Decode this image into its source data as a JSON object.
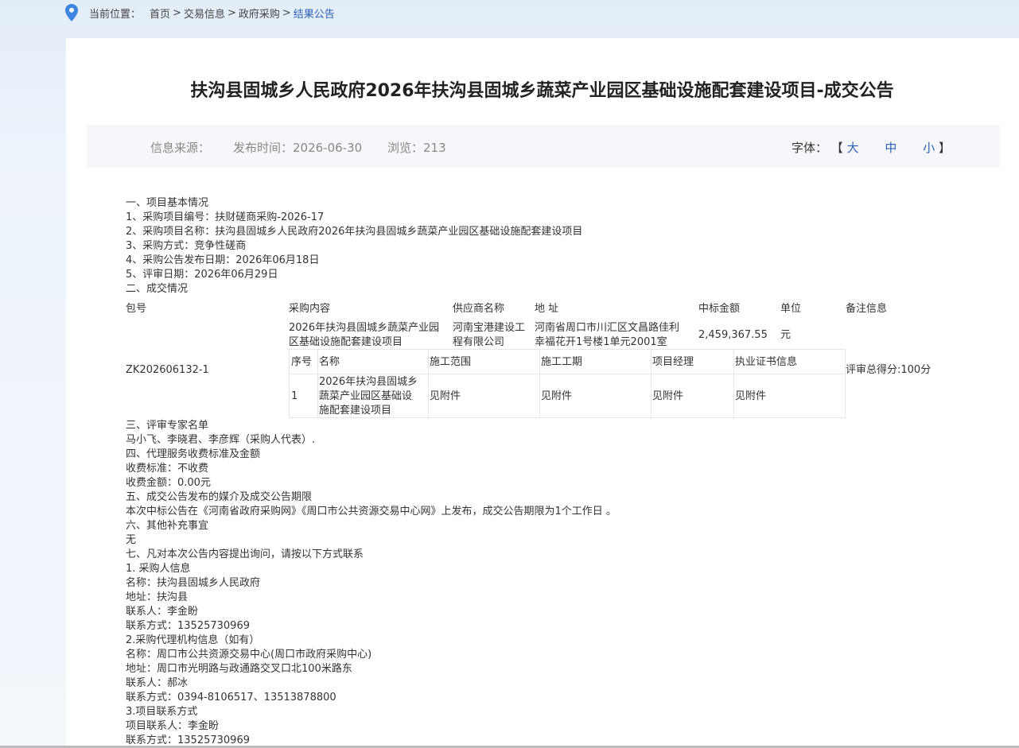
{
  "breadcrumb": {
    "prefix": "当前位置：",
    "items": [
      "首页",
      "交易信息",
      "政府采购"
    ],
    "separator": ">",
    "current": "结果公告"
  },
  "title": "扶沟县固城乡人民政府2026年扶沟县固城乡蔬菜产业园区基础设施配套建设项目-成交公告",
  "info": {
    "source": "信息来源：",
    "publish_time": "发布时间：2026-06-30",
    "views": "浏览：213",
    "font_label": "字体：",
    "bracket_open": "【",
    "bracket_close": "】",
    "font_large": "大",
    "font_medium": "中",
    "font_small": "小"
  },
  "section1": [
    "一、项目基本情况",
    "1、采购项目编号：扶财磋商采购-2026-17",
    "2、采购项目名称：扶沟县固城乡人民政府2026年扶沟县固城乡蔬菜产业园区基础设施配套建设项目",
    "3、采购方式：竞争性磋商",
    "4、采购公告发布日期：2026年06月18日",
    "5、评审日期：2026年06月29日",
    "二、成交情况"
  ],
  "deal_table": {
    "headers": {
      "package": "包号",
      "content": "采购内容",
      "supplier": "供应商名称",
      "address": "地 址",
      "amount": "中标金额",
      "unit": "单位",
      "remark": "备注信息"
    },
    "row": {
      "package": "ZK202606132-1",
      "content_l1": "2026年扶沟县固城乡蔬菜产业园",
      "content_l2": "区基础设施配套建设项目",
      "supplier_l1": "河南宝港建设工",
      "supplier_l2": "程有限公司",
      "address_l1": "河南省周口市川汇区文昌路佳利",
      "address_l2": "幸福花开1号楼1单元2001室",
      "amount": "2,459,367.55",
      "unit": "元",
      "remark": "评审总得分:100分"
    },
    "inner_headers": {
      "no": "序号",
      "name": "名称",
      "scope": "施工范围",
      "period": "施工工期",
      "manager": "项目经理",
      "cert": "执业证书信息"
    },
    "inner_row": {
      "no": "1",
      "name_l1": "2026年扶沟县固城乡",
      "name_l2": "蔬菜产业园区基础设",
      "name_l3": "施配套建设项目",
      "scope": "见附件",
      "period": "见附件",
      "manager": "见附件",
      "cert": "见附件"
    }
  },
  "section2": [
    "三、评审专家名单",
    "马小飞、李晓君、李彦辉（采购人代表）.",
    "四、代理服务收费标准及金额",
    "收费标准：不收费",
    "收费金额：0.00元",
    "五、成交公告发布的媒介及成交公告期限",
    "本次中标公告在《河南省政府采购网》《周口市公共资源交易中心网》上发布，成交公告期限为1个工作日 。",
    "六、其他补充事宜",
    "无",
    "七、凡对本次公告内容提出询问，请按以下方式联系",
    "1. 采购人信息",
    "名称：扶沟县固城乡人民政府",
    "地址：扶沟县",
    "联系人：李金盼",
    "联系方式：13525730969",
    "2.采购代理机构信息（如有）",
    "名称：周口市公共资源交易中心(周口市政府采购中心)",
    "地址：周口市光明路与政通路交叉口北100米路东",
    "联系人：郝冰",
    "联系方式：0394-8106517、13513878800",
    "3.项目联系方式",
    "项目联系人：李金盼",
    "联系方式：13525730969"
  ],
  "colors": {
    "accent": "#2a62b8",
    "pin": "#3a86e0"
  }
}
